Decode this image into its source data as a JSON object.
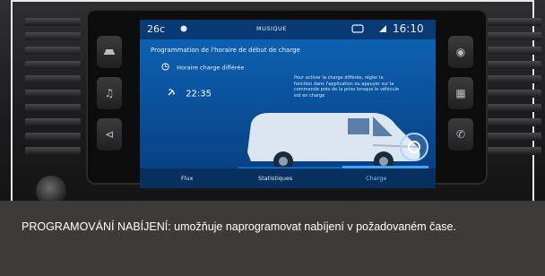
{
  "screen": {
    "status_bar": {
      "temperature": "26c",
      "source": "MUSIQUE",
      "time": "16:10"
    },
    "title": "Programmation de l'horaire de début de charge",
    "deferred_label": "Horaire charge différée",
    "deferred_time": "22:35",
    "help_text": "Pour activer la charge différée, régler la fonction dans l'application ou appuyer sur la commande près de la prise lorsque le véhicule est en charge",
    "tabs": [
      {
        "label": "Flux"
      },
      {
        "label": "Statistiques"
      },
      {
        "label": "Charge",
        "active": true
      }
    ]
  },
  "caption": {
    "heading": "PROGRAMOVÁNÍ NABÍJENÍ",
    "text": ": umožňuje naprogramovat nabíjení v požadovaném čase."
  },
  "colors": {
    "screen_blue": "#0e66b7",
    "active_tab": "#3ea6ff",
    "caption_text": "#ffffff",
    "page_background": "#3d3b3a"
  }
}
